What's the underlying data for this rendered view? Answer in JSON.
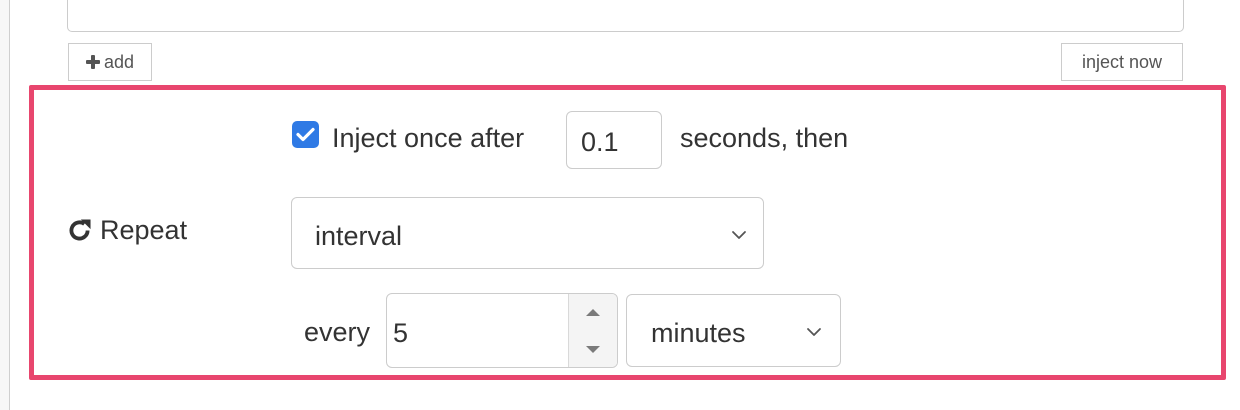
{
  "toolbar": {
    "add_label": "add",
    "add_icon": "plus-icon",
    "inject_now_label": "inject now"
  },
  "repeat_section": {
    "accent_color": "#e8466e",
    "inject_once": {
      "checked": true,
      "label_before": "Inject once after",
      "delay_value": "0.1",
      "label_after": "seconds, then"
    },
    "repeat_label": "Repeat",
    "repeat_icon": "refresh-icon",
    "repeat_mode": "interval",
    "every_label": "every",
    "interval_value": "5",
    "interval_units": "minutes"
  }
}
